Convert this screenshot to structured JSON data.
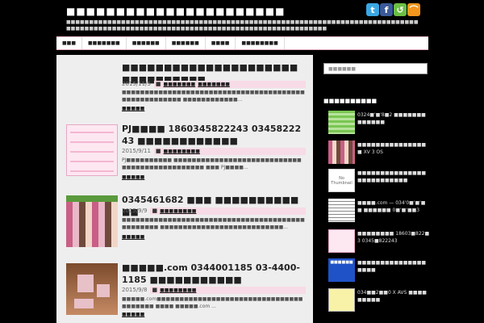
{
  "header": {
    "site_title": "■■■■■■■■■■■■■■■■■■■■■■",
    "tagline": "■■■■■■■■■■■■■■■■■■■■■■■■■■■■■■■■■■■■■■■■■■■■■■■■■■■■■■■■■■■■■■■■■■■■■■■■■■■■■■■■■■■■■■■■■■■■■■■■■■■■■■■■■■■■■■■■■■■■■■■■■■■■■■■■■■■■■■",
    "social": [
      "t",
      "f",
      "↺",
      "⌒"
    ]
  },
  "nav": [
    "■■■",
    "■■■■■■■",
    "■■■■■■",
    "■■■■■■",
    "■■■■",
    "■■■■■■■■"
  ],
  "posts": [
    {
      "title": "■■■■■■■■■■■■■■■■■■■■■■■■■■■■■■■",
      "date": "2015/11/5",
      "categories": [
        "■■■■■■■",
        "■■■■■■■"
      ],
      "excerpt": "■■■■■■■■■■■■■■■■■■■■■■■■■■■■■■■■■■■■■■■■■■■■■■■■■■■■■ ■■■■■■■■■■■■...",
      "more": "■■■■■"
    },
    {
      "title": "PJ■■■■ 1860345822243 0345822243 ■■■■■■■■■■■■",
      "date": "2015/9/11",
      "categories": [
        "■■■■■■■■"
      ],
      "excerpt": "PJ■■■■■■■■■■ ■■■■■■■■■■■■■■■■■■■■■■■■■■■■■■■■■■■■■■■■■■■■■■ ■■■ PJ■■■■...",
      "more": "■■■■■"
    },
    {
      "title": "0345461682 ■■■ ■■■■■■■■■■■■",
      "date": "2015/9/9",
      "categories": [
        "■■■■■■■■"
      ],
      "excerpt": "■■■■■■■■■■■■■■■■■■■■■■■■■■■■■■■■■■■■■■■■■■■■■■■■ ■■■■■■■■■■■■■■■■■■■■■■■■■■■...",
      "more": "■■■■■"
    },
    {
      "title": "■■■■■.com 0344001185 03-4400-1185 ■■■■■■■■■■■",
      "date": "2015/9/8",
      "categories": [
        "■■■■■■■■"
      ],
      "excerpt": "■■■■■.com■■■■■■■■■■■■■■■■■■■■■■■■■■■■■■■■■■■■■■■ ■■■■ ■■■■■.com ...",
      "more": "■■■■■"
    }
  ],
  "sidebar": {
    "search_placeholder": "■■■■■■",
    "heading": "■■■■■■■■■■",
    "items": [
      {
        "text": "0324■'■'8■2 ■■■■■■■■■■■■■"
      },
      {
        "text": "■■■■■■■■■■■■■■■■ XV 3 OS"
      },
      {
        "text": "■■■■■■■■■■■■■■■■■■■■■■■■■■",
        "thumb_label": "No Thumbnail"
      },
      {
        "text": "■■■■.com — 034'0■'■'■■ ■■■■■■ 0■'■'■■3"
      },
      {
        "text": "■■■■■■■■ 18603■822■3 0345■822243"
      },
      {
        "text": "■■■■■■■■■■■■■■■■■■■",
        "thumb_label": "■■■■■■"
      },
      {
        "text": "034■■2■■0 X AVS ■■■■■■■■■"
      }
    ]
  }
}
